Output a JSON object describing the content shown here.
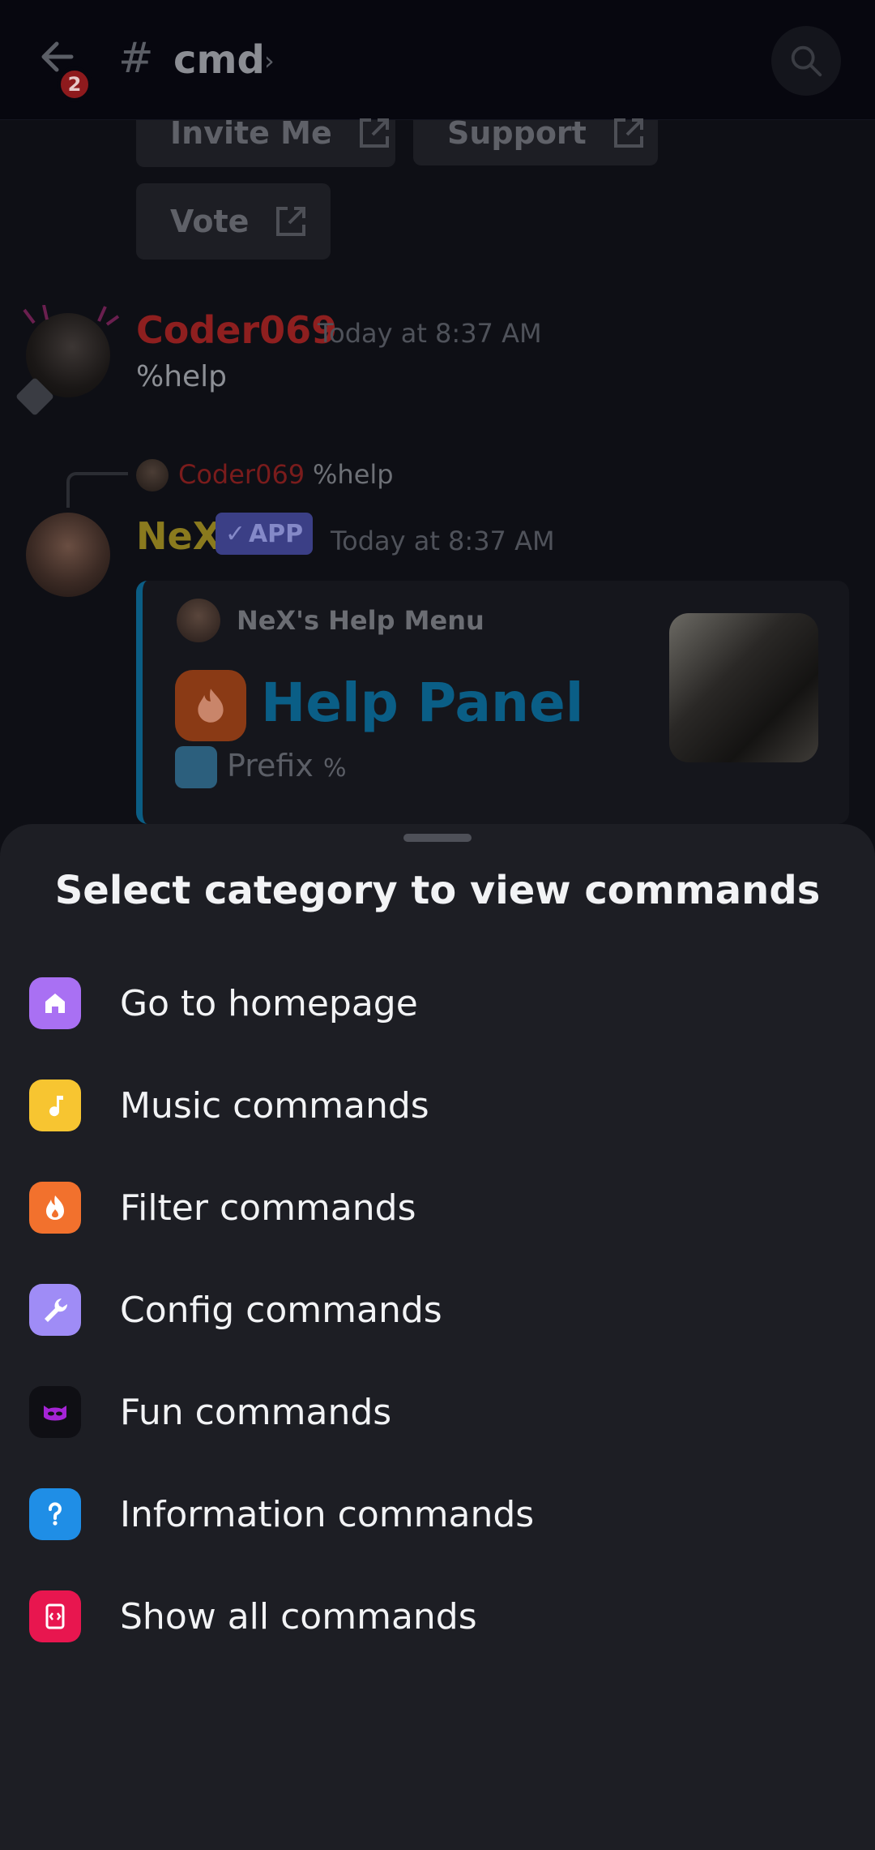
{
  "header": {
    "unread_count": "2",
    "channel_hash": "#",
    "channel_name": "cmd",
    "chevron": "›"
  },
  "link_buttons": {
    "invite": "Invite Me",
    "support": "Support",
    "vote": "Vote"
  },
  "messages": {
    "user_message": {
      "author": "Coder069",
      "author_color": "#8e1f1f",
      "timestamp": "Today at 8:37 AM",
      "text": "%help"
    },
    "reply_ref": {
      "author": "Coder069",
      "text": "%help"
    },
    "bot_message": {
      "author": "NeX",
      "author_color": "#8a7a1e",
      "app_tag": "APP",
      "timestamp": "Today at 8:37 AM",
      "embed": {
        "author": "NeX's Help Menu",
        "title": "Help Panel",
        "prefix_label": "Prefix",
        "prefix_value": "%",
        "accent_color": "#0b5d84"
      }
    }
  },
  "sheet": {
    "title": "Select category to view commands",
    "items": [
      {
        "label": "Go to homepage",
        "icon": "home-icon",
        "color": "#a970f3"
      },
      {
        "label": "Music commands",
        "icon": "music-note-icon",
        "color": "#f7c531"
      },
      {
        "label": "Filter commands",
        "icon": "flame-icon",
        "color": "#f2712d"
      },
      {
        "label": "Config commands",
        "icon": "wrench-icon",
        "color": "#9f8cf6"
      },
      {
        "label": "Fun commands",
        "icon": "mask-icon",
        "color": "#0f0f14"
      },
      {
        "label": "Information commands",
        "icon": "question-icon",
        "color": "#1f8ee6"
      },
      {
        "label": "Show all commands",
        "icon": "code-icon",
        "color": "#e8164f"
      }
    ]
  }
}
